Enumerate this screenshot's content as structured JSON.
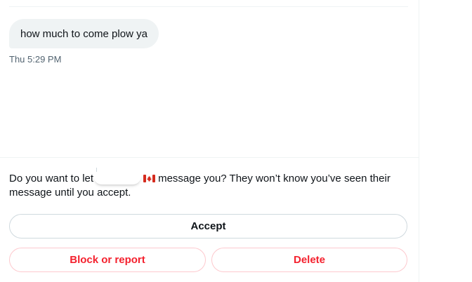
{
  "conversation": {
    "message": {
      "text": "how much to come plow ya",
      "timestamp": "Thu 5:29 PM"
    }
  },
  "request": {
    "prompt_before": "Do you want to let",
    "prompt_after": "message you? They won’t know you’ve seen their message until you accept.",
    "flag_icon": "canada-flag-icon"
  },
  "actions": {
    "accept_label": "Accept",
    "block_label": "Block or report",
    "delete_label": "Delete"
  },
  "colors": {
    "danger": "#f4212e",
    "bubble_bg": "#eff3f4",
    "text_secondary": "#536471"
  }
}
